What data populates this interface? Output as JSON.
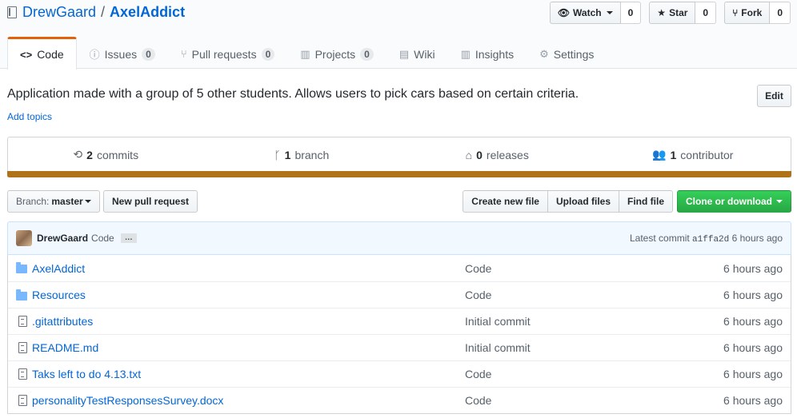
{
  "repo": {
    "owner": "DrewGaard",
    "separator": "/",
    "name": "AxelAddict"
  },
  "actions": {
    "watch": {
      "label": "Watch",
      "count": "0"
    },
    "star": {
      "label": "Star",
      "count": "0"
    },
    "fork": {
      "label": "Fork",
      "count": "0"
    }
  },
  "tabs": [
    {
      "label": "Code",
      "icon": "<>",
      "icon_name": "code-icon"
    },
    {
      "label": "Issues",
      "counter": "0",
      "icon": "ⓘ",
      "icon_name": "issue-icon"
    },
    {
      "label": "Pull requests",
      "counter": "0",
      "icon": "⑂",
      "icon_name": "pull-request-icon"
    },
    {
      "label": "Projects",
      "counter": "0",
      "icon": "▥",
      "icon_name": "project-icon"
    },
    {
      "label": "Wiki",
      "icon": "▤",
      "icon_name": "book-icon"
    },
    {
      "label": "Insights",
      "icon": "▥",
      "icon_name": "graph-icon"
    },
    {
      "label": "Settings",
      "icon": "⚙",
      "icon_name": "gear-icon"
    }
  ],
  "description": "Application made with a group of 5 other students. Allows users to pick cars based on certain criteria.",
  "add_topics": "Add topics",
  "edit_label": "Edit",
  "summary": {
    "commits": {
      "count": "2",
      "label": "commits"
    },
    "branches": {
      "count": "1",
      "label": "branch"
    },
    "releases": {
      "count": "0",
      "label": "releases"
    },
    "contributors": {
      "count": "1",
      "label": "contributor"
    },
    "language_color": "#b07219"
  },
  "file_nav": {
    "branch_label": "Branch:",
    "branch_value": "master",
    "new_pr": "New pull request",
    "create_file": "Create new file",
    "upload_files": "Upload files",
    "find_file": "Find file",
    "clone": "Clone or download"
  },
  "latest_commit": {
    "author": "DrewGaard",
    "message": "Code",
    "ellipsis": "…",
    "prefix": "Latest commit",
    "sha": "a1ffa2d",
    "age": "6 hours ago"
  },
  "files": [
    {
      "type": "dir",
      "name": "AxelAddict",
      "message": "Code",
      "age": "6 hours ago"
    },
    {
      "type": "dir",
      "name": "Resources",
      "message": "Code",
      "age": "6 hours ago"
    },
    {
      "type": "file",
      "name": ".gitattributes",
      "message": "Initial commit",
      "age": "6 hours ago"
    },
    {
      "type": "file",
      "name": "README.md",
      "message": "Initial commit",
      "age": "6 hours ago"
    },
    {
      "type": "file",
      "name": "Taks left to do 4.13.txt",
      "message": "Code",
      "age": "6 hours ago"
    },
    {
      "type": "file",
      "name": "personalityTestResponsesSurvey.docx",
      "message": "Code",
      "age": "6 hours ago"
    }
  ]
}
